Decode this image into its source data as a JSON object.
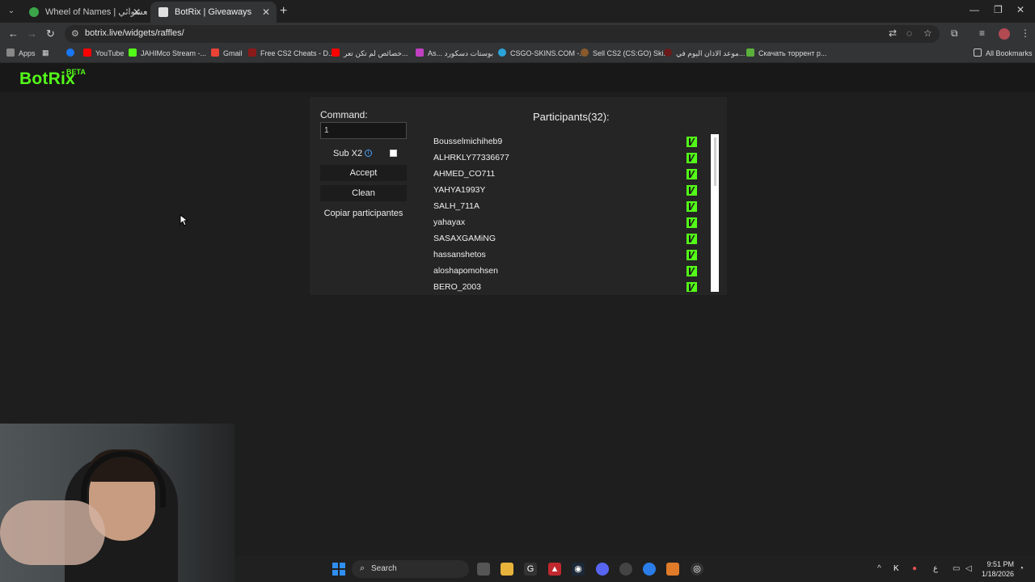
{
  "browser": {
    "tabs": [
      {
        "title": "Wheel of Names | أسم العشوائي",
        "active": false
      },
      {
        "title": "BotRix | Giveaways",
        "active": true
      }
    ],
    "new_tab_icon": "plus-icon",
    "url": "botrix.live/widgets/raffles/",
    "bookmarks": [
      {
        "label": "Apps",
        "color": "#4285f4"
      },
      {
        "label": "YouTube",
        "color": "#1877f2"
      },
      {
        "label": "JAHIMco Stream -...",
        "color": "#53fc18"
      },
      {
        "label": "Gmail",
        "color": "#ea4335"
      },
      {
        "label": "Free CS2 Cheats - D...",
        "color": "#8b1a1a"
      },
      {
        "label": "خصائص لم تكن تعر...",
        "color": "#ff0000"
      },
      {
        "label": "As... بوستات دسكورد",
        "color": "#c040c0"
      },
      {
        "label": "CSGO-SKINS.COM -...",
        "color": "#2aa3d8"
      },
      {
        "label": "Sell CS2 (CS:GO) Ski...",
        "color": "#8a5a2b"
      },
      {
        "label": "موعد الاذان اليوم في...",
        "color": "#6a1a1a"
      },
      {
        "label": "Скачать торрент р...",
        "color": "#5ab03a"
      }
    ],
    "all_bookmarks": "All Bookmarks"
  },
  "site": {
    "logo": "BotRix",
    "beta": "BETA"
  },
  "raffle": {
    "command_label": "Command:",
    "command_value": "1",
    "sub_label": "Sub X2",
    "sub_checked": false,
    "accept_label": "Accept",
    "clean_label": "Clean",
    "copy_label": "Copiar participantes",
    "participants_title": "Participants(32):",
    "participants": [
      "Bousselmichiheb9",
      "ALHRKLY77336677",
      "AHMED_CO711",
      "YAHYA1993Y",
      "SALH_711A",
      "yahayax",
      "SASAXGAMiNG",
      "hassanshetos",
      "aloshapomohsen",
      "BERO_2003"
    ]
  },
  "taskbar": {
    "search_label": "Search",
    "time": "9:51 PM",
    "date": "1/18/2026",
    "lang": "ع"
  }
}
